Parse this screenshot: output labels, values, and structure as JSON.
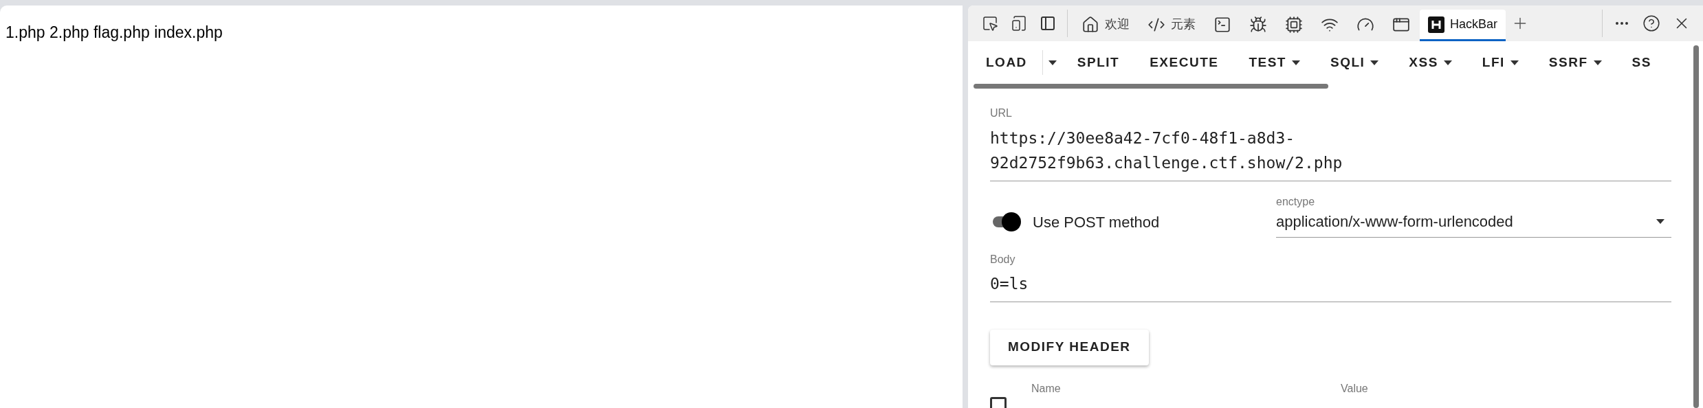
{
  "page": {
    "text": "1.php 2.php flag.php index.php"
  },
  "devtools": {
    "tabs": [
      {
        "label": "欢迎",
        "selected": false
      },
      {
        "label": "元素",
        "selected": false
      },
      {
        "selected": false
      },
      {
        "selected": false
      },
      {
        "selected": false
      },
      {
        "selected": false
      },
      {
        "selected": false
      },
      {
        "selected": false
      },
      {
        "label": "HackBar",
        "selected": true
      }
    ]
  },
  "hackbar": {
    "menu": [
      {
        "label": "LOAD",
        "kind": "split"
      },
      {
        "label": "SPLIT",
        "kind": "plain"
      },
      {
        "label": "EXECUTE",
        "kind": "plain"
      },
      {
        "label": "TEST",
        "kind": "dropdown"
      },
      {
        "label": "SQLI",
        "kind": "dropdown"
      },
      {
        "label": "XSS",
        "kind": "dropdown"
      },
      {
        "label": "LFI",
        "kind": "dropdown"
      },
      {
        "label": "SSRF",
        "kind": "dropdown"
      },
      {
        "label": "SS",
        "kind": "plain"
      }
    ],
    "url": {
      "label": "URL",
      "value": "https://30ee8a42-7cf0-48f1-a8d3-92d2752f9b63.challenge.ctf.show/2.php"
    },
    "post_toggle": {
      "label": "Use POST method",
      "on": true
    },
    "enctype": {
      "label": "enctype",
      "value": "application/x-www-form-urlencoded"
    },
    "body": {
      "label": "Body",
      "value": "0=ls"
    },
    "modify_header_button": "MODIFY HEADER",
    "headers": {
      "select_all": {
        "checked": false
      },
      "columns": [
        "Name",
        "Value"
      ]
    }
  }
}
